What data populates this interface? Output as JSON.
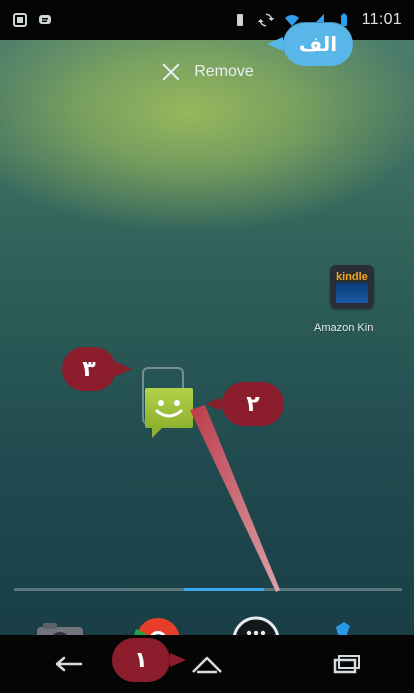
{
  "status_bar": {
    "time": "11:01",
    "left_icons": [
      "screenshot-icon",
      "chat-icon"
    ],
    "right_icons": [
      "vibrate-icon",
      "sync-icon",
      "wifi-icon",
      "signal-icon",
      "battery-icon"
    ]
  },
  "remove_bar": {
    "label": "Remove",
    "icon": "close-icon"
  },
  "callouts": {
    "alef": "الف",
    "three": "۳",
    "two": "۲",
    "one": "۱"
  },
  "apps": {
    "kindle": {
      "label": "Amazon Kin",
      "icon_text": "kindle"
    }
  },
  "dock": {
    "items": [
      "camera-icon",
      "chrome-icon",
      "all-apps-icon",
      "phone-icon"
    ]
  },
  "colors": {
    "alef_bubble": "#58b6e9",
    "numbered_bubbles": "#8b1d2d",
    "dock_indicator": "#3ea5ee",
    "message_icon": "#a4c53f"
  }
}
